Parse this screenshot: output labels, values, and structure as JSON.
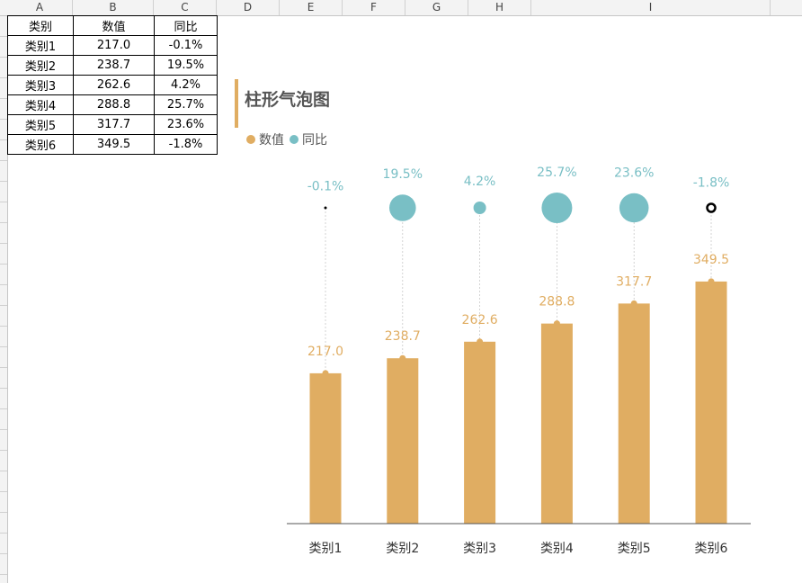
{
  "sheet": {
    "columns": [
      "A",
      "B",
      "C",
      "D",
      "E",
      "F",
      "G",
      "H",
      "I"
    ],
    "table": {
      "headers": [
        "类别",
        "数值",
        "同比"
      ],
      "rows": [
        [
          "类别1",
          "217.0",
          "-0.1%"
        ],
        [
          "类别2",
          "238.7",
          "19.5%"
        ],
        [
          "类别3",
          "262.6",
          "4.2%"
        ],
        [
          "类别4",
          "288.8",
          "25.7%"
        ],
        [
          "类别5",
          "317.7",
          "23.6%"
        ],
        [
          "类别6",
          "349.5",
          "-1.8%"
        ]
      ]
    }
  },
  "chart": {
    "title": "柱形气泡图",
    "legend": [
      {
        "label": "数值",
        "color": "#e0ad62"
      },
      {
        "label": "同比",
        "color": "#79bfc5"
      }
    ]
  },
  "chart_data": {
    "type": "bar",
    "title": "柱形气泡图",
    "categories": [
      "类别1",
      "类别2",
      "类别3",
      "类别4",
      "类别5",
      "类别6"
    ],
    "series": [
      {
        "name": "数值",
        "values": [
          217.0,
          238.7,
          262.6,
          288.8,
          317.7,
          349.5
        ],
        "labels": [
          "217.0",
          "238.7",
          "262.6",
          "288.8",
          "317.7",
          "349.5"
        ],
        "color": "#e0ad62"
      },
      {
        "name": "同比",
        "type": "bubble",
        "values": [
          -0.1,
          19.5,
          4.2,
          25.7,
          23.6,
          -1.8
        ],
        "labels": [
          "-0.1%",
          "19.5%",
          "4.2%",
          "25.7%",
          "23.6%",
          "-1.8%"
        ],
        "color": "#79bfc5"
      }
    ],
    "ylim": [
      0,
      350
    ],
    "grid": false,
    "legend_position": "top-left"
  }
}
